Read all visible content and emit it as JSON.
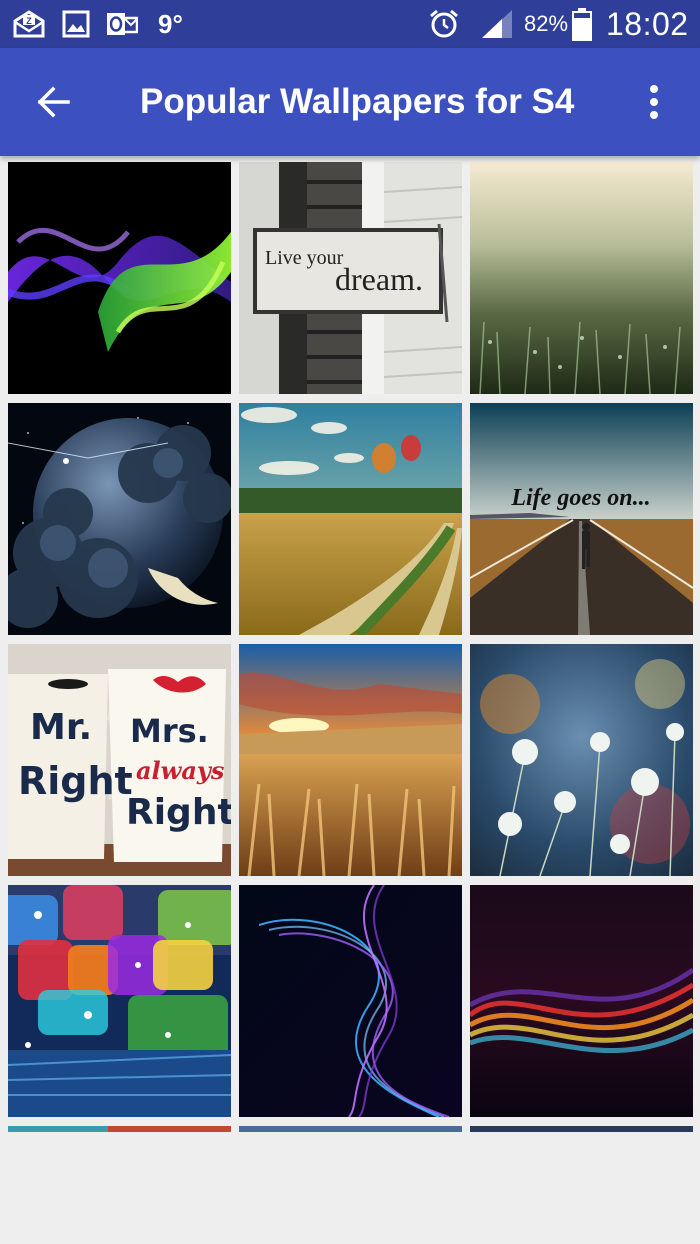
{
  "status_bar": {
    "icons": [
      "email-notification-icon",
      "gallery-icon",
      "outlook-icon",
      "alarm-icon",
      "signal-icon",
      "battery-icon"
    ],
    "temperature": "9°",
    "battery_percent": "82%",
    "battery_level": 0.82,
    "time": "18:02"
  },
  "app_bar": {
    "back_icon": "arrow-back-icon",
    "title": "Popular Wallpapers for S4",
    "menu_icon": "more-vert-icon"
  },
  "wallpapers": [
    {
      "name": "colorful-smoke"
    },
    {
      "name": "live-your-dream-sign",
      "text_line1": "Live your",
      "text_line2": "dream."
    },
    {
      "name": "grass-bokeh"
    },
    {
      "name": "planet-clouds"
    },
    {
      "name": "balloons-field-road"
    },
    {
      "name": "life-goes-on-road",
      "text": "Life goes on..."
    },
    {
      "name": "mr-mrs-right-mugs",
      "mug1_line1": "Mr.",
      "mug1_line2": "Right",
      "mug2_line1": "Mrs.",
      "mug2_line2": "always",
      "mug2_line3": "Right"
    },
    {
      "name": "wheat-sunset"
    },
    {
      "name": "dandelions"
    },
    {
      "name": "colorful-squares"
    },
    {
      "name": "blue-purple-swirl"
    },
    {
      "name": "rainbow-waves"
    }
  ],
  "colors": {
    "status_bar": "#2f3e98",
    "app_bar": "#3d50c0",
    "background": "#eeeeee"
  }
}
